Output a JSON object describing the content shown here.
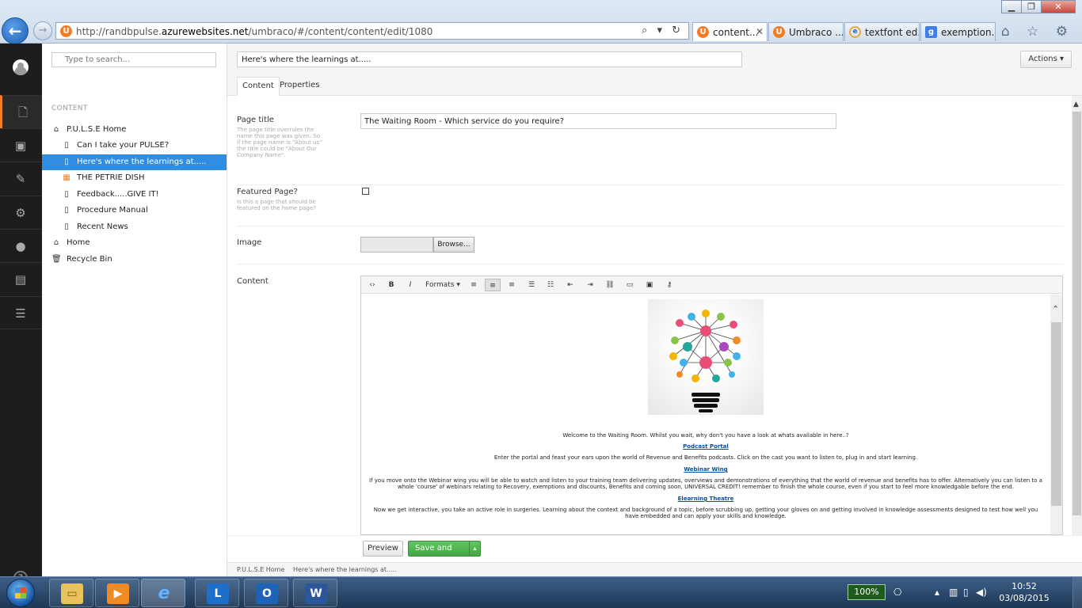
{
  "browser": {
    "url_prefix": "http://randbpulse.",
    "url_domain": "azurewebsites.net",
    "url_path": "/umbraco/#/content/content/edit/1080",
    "url_controls": "⌕ ▾ ↻",
    "tabs": [
      {
        "label": "content...",
        "icon": "umbraco-icon",
        "active": true,
        "close": "✕"
      },
      {
        "label": "Umbraco ...",
        "icon": "umbraco-icon",
        "active": false
      },
      {
        "label": "textfont ed...",
        "icon": "ie-icon",
        "active": false
      },
      {
        "label": "exemption...",
        "icon": "google-icon",
        "active": false
      }
    ],
    "window_buttons": {
      "minimize": "▁",
      "maximize": "❐",
      "close": "✕"
    },
    "right_tools": "⌂ ☆ ⚙",
    "back_glyph": "←",
    "forward_glyph": "→"
  },
  "sections": [
    {
      "name": "content",
      "icon": "document-icon",
      "glyph": "🗋",
      "active": true
    },
    {
      "name": "media",
      "icon": "image-icon",
      "glyph": "▣",
      "active": false
    },
    {
      "name": "developer",
      "icon": "wrench-icon",
      "glyph": "✎",
      "active": false
    },
    {
      "name": "settings",
      "icon": "gear-icon",
      "glyph": "⚙",
      "active": false
    },
    {
      "name": "users",
      "icon": "user-icon",
      "glyph": "●",
      "active": false
    },
    {
      "name": "members",
      "icon": "id-card-icon",
      "glyph": "▤",
      "active": false
    },
    {
      "name": "forms",
      "icon": "server-icon",
      "glyph": "☰",
      "active": false
    }
  ],
  "help_glyph": "?",
  "tree": {
    "search_placeholder": "Type to search...",
    "search_glyph": "⌕",
    "heading": "CONTENT",
    "items": [
      {
        "label": "P.U.L.S.E Home",
        "icon": "home-icon",
        "glyph": "⌂",
        "level": 0,
        "selected": false
      },
      {
        "label": "Can I take your PULSE?",
        "icon": "document-icon",
        "glyph": "▯",
        "level": 1,
        "selected": false
      },
      {
        "label": "Here's where the learnings at.....",
        "icon": "document-icon",
        "glyph": "▯",
        "level": 1,
        "selected": true
      },
      {
        "label": "THE PETRIE DISH",
        "icon": "box-icon",
        "glyph": "▦",
        "level": 1,
        "selected": false
      },
      {
        "label": "Feedback.....GIVE IT!",
        "icon": "document-icon",
        "glyph": "▯",
        "level": 1,
        "selected": false
      },
      {
        "label": "Procedure Manual",
        "icon": "document-icon",
        "glyph": "▯",
        "level": 1,
        "selected": false
      },
      {
        "label": "Recent News",
        "icon": "document-icon",
        "glyph": "▯",
        "level": 1,
        "selected": false
      },
      {
        "label": "Home",
        "icon": "home-icon",
        "glyph": "⌂",
        "level": 0,
        "selected": false
      },
      {
        "label": "Recycle Bin",
        "icon": "trash-icon",
        "glyph": "🗑",
        "level": 0,
        "selected": false
      }
    ]
  },
  "editor": {
    "node_name": "Here's where the learnings at.....",
    "actions_label": "Actions ▾",
    "tabs": [
      {
        "label": "Content",
        "active": true
      },
      {
        "label": "Properties",
        "active": false
      }
    ],
    "properties": {
      "page_title": {
        "label": "Page title",
        "description": "The page title overrules the name this page was given. So if the page name is \"About us\" the title could be \"About Our Company Name\".",
        "value": "The Waiting Room - Which service do you require?"
      },
      "featured": {
        "label": "Featured Page?",
        "description": "Is this a page that should be featured on the home page?",
        "checked": false
      },
      "image": {
        "label": "Image",
        "browse_label": "Browse..."
      },
      "content": {
        "label": "Content"
      }
    },
    "rte_toolbar": [
      {
        "name": "source-code",
        "glyph": "‹›"
      },
      {
        "name": "bold",
        "glyph": "B"
      },
      {
        "name": "italic",
        "glyph": "I"
      },
      {
        "name": "formats",
        "glyph": "Formats ▾"
      },
      {
        "name": "align-left",
        "glyph": "≡"
      },
      {
        "name": "align-center",
        "glyph": "≡"
      },
      {
        "name": "align-right",
        "glyph": "≡"
      },
      {
        "name": "bullet-list",
        "glyph": "☰"
      },
      {
        "name": "numbered-list",
        "glyph": "☷"
      },
      {
        "name": "outdent",
        "glyph": "⇤"
      },
      {
        "name": "indent",
        "glyph": "⇥"
      },
      {
        "name": "link",
        "glyph": "⛓"
      },
      {
        "name": "anchor",
        "glyph": "▭"
      },
      {
        "name": "media-picker",
        "glyph": "▣"
      },
      {
        "name": "macro",
        "glyph": "⚷"
      }
    ],
    "rte_content": {
      "intro": "Welcome to the Waiting Room. Whilst you wait, why don't you have a look at whats available in here..?",
      "podcast_link": "Podcast Portal",
      "podcast_text": "Enter the portal and feast your ears upon the world of Revenue and Benefits podcasts. Click on the cast you want to listen to, plug in and start learning.",
      "webinar_link": "Webinar Wing",
      "webinar_text": "If you move onto the Webinar wing you will be able to watch and listen to your training team delivering updates, overviews and demonstrations of everything that the world of revenue and benefits has to offer. Alternatively you can listen to a whole 'course' of webinars relating to Recovery, exemptions and discounts, Benefits and coming soon, UNIVERSAL CREDIT! remember to finish the whole course, even if you start to feel more knowledgable before the end.",
      "elearning_link": "Elearning Theatre",
      "elearning_text": "Now we get interactive, you take an active role in surgeries. Learning about the context and background of a topic, before scrubbing up, getting your gloves on and getting involved in knowledge assessments designed to test how well you have embedded and can apply your skills and knowledge."
    },
    "preview_label": "Preview",
    "save_publish_label": "Save and publish",
    "save_publish_caret": "▴",
    "breadcrumb": [
      "P.U.L.S.E Home",
      "Here's where the learnings at....."
    ]
  },
  "taskbar": {
    "apps": [
      {
        "name": "explorer",
        "icon": "folder-icon",
        "glyph": "▭",
        "color": "#e8c25a"
      },
      {
        "name": "media-player",
        "icon": "play-icon",
        "glyph": "▶",
        "color": "#f08a24"
      },
      {
        "name": "internet-explorer",
        "icon": "ie-icon",
        "glyph": "e",
        "color": "#2a7fd4"
      },
      {
        "name": "lync",
        "icon": "lync-icon",
        "glyph": "L",
        "color": "#1e6fc9"
      },
      {
        "name": "outlook",
        "icon": "outlook-icon",
        "glyph": "O",
        "color": "#1d63b8"
      },
      {
        "name": "word",
        "icon": "word-icon",
        "glyph": "W",
        "color": "#2b579a"
      }
    ],
    "battery": "100%",
    "tray_glyphs": [
      "▴",
      "▥",
      "▯",
      "◀)"
    ],
    "time": "10:52",
    "date": "03/08/2015"
  }
}
